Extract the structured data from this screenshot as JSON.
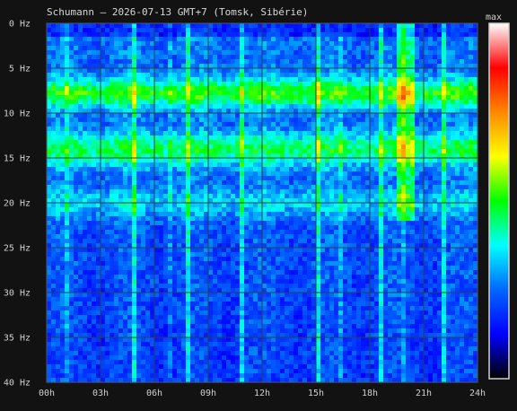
{
  "chart_data": {
    "type": "heatmap",
    "title": "Schumann — 2026-07-13 GMT+7  (Tomsk, Sibérie)",
    "xlabel": "",
    "ylabel": "",
    "x_ticks": [
      "00h",
      "03h",
      "06h",
      "09h",
      "12h",
      "15h",
      "18h",
      "21h",
      "24h"
    ],
    "y_ticks": [
      "0 Hz",
      "5 Hz",
      "10 Hz",
      "15 Hz",
      "20 Hz",
      "25 Hz",
      "30 Hz",
      "35 Hz",
      "40 Hz"
    ],
    "x_range_hours": [
      0,
      24
    ],
    "y_range_hz": [
      0,
      40
    ],
    "y_inverted": true,
    "grid": true,
    "colorbar_label": "max",
    "colorbar_stops": [
      "#ffffff",
      "#ff0000",
      "#ff8800",
      "#ffff00",
      "#00ff00",
      "#00ffff",
      "#0066ff",
      "#0000ff",
      "#000000"
    ],
    "resonance_bands_hz": [
      7.8,
      14.1,
      20.0
    ],
    "vertical_bursts_hours": [
      1.2,
      4.9,
      6.8,
      7.9,
      10.9,
      15.1,
      16.3,
      18.6,
      19.8,
      22.1,
      23.0
    ]
  }
}
